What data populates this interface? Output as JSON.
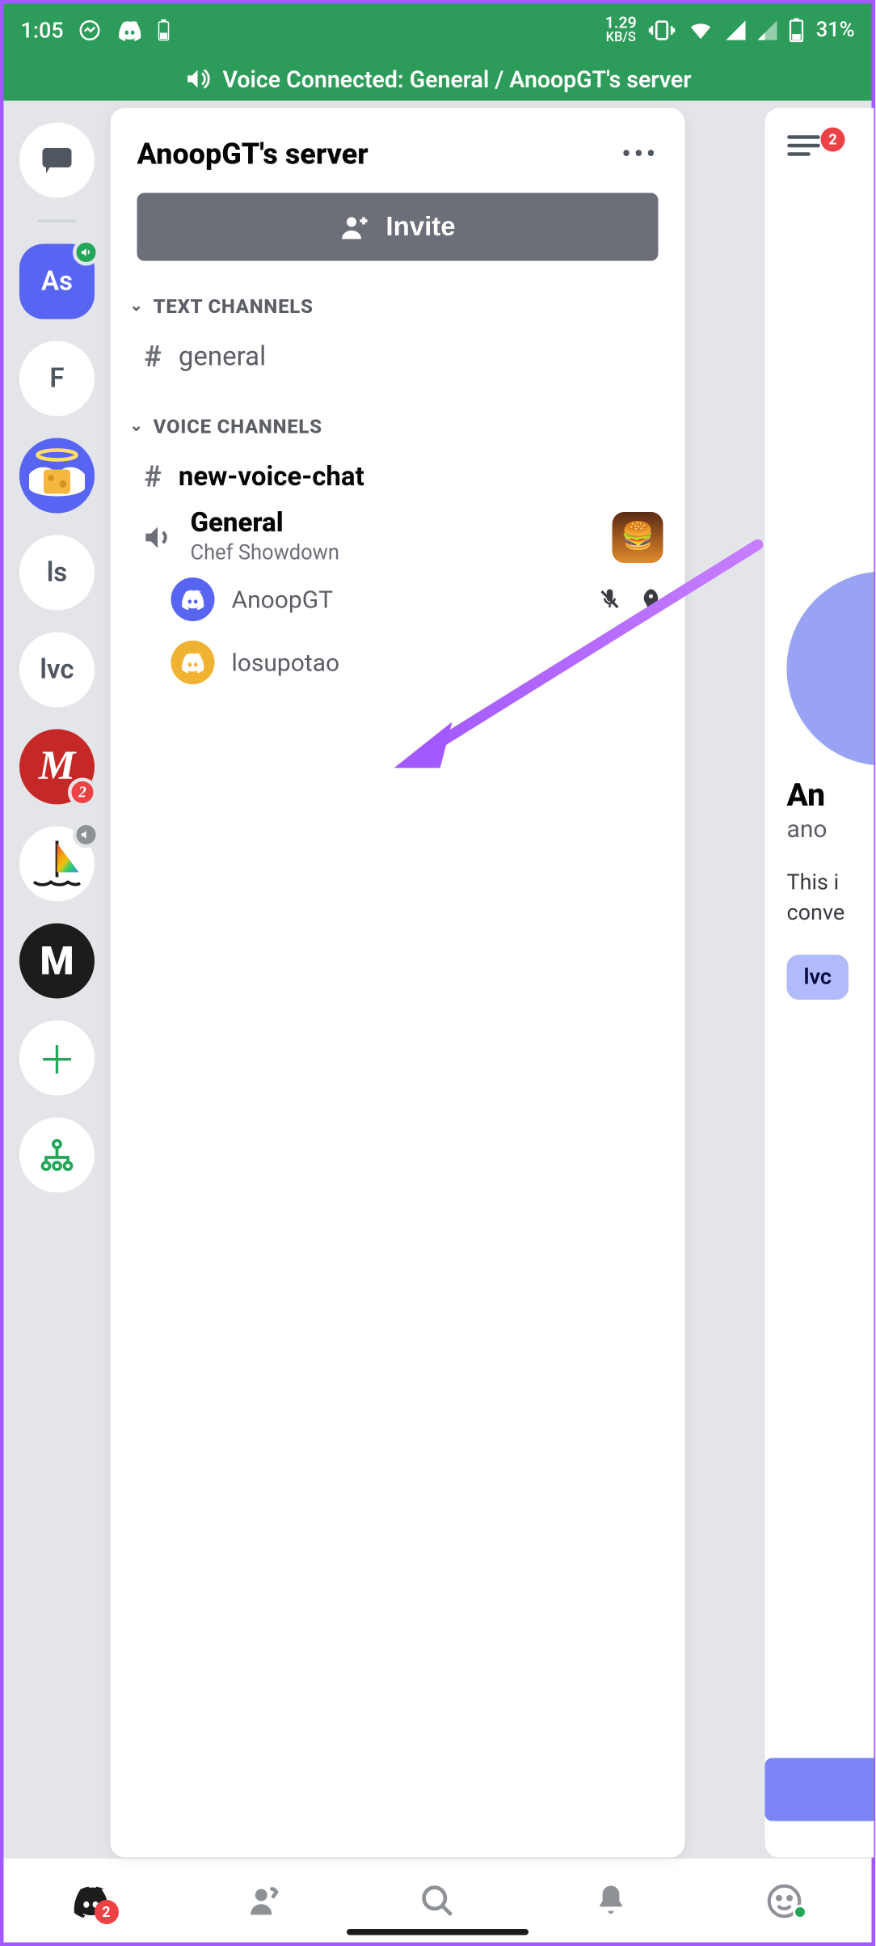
{
  "status": {
    "time": "1:05",
    "net_speed": "1.29",
    "net_unit": "KB/S",
    "battery": "31%"
  },
  "voice_banner": "Voice Connected: General / AnoopGT's server",
  "server": {
    "title": "AnoopGT's server",
    "invite_label": "Invite"
  },
  "sections": {
    "text_label": "TEXT CHANNELS",
    "voice_label": "VOICE CHANNELS"
  },
  "text_channels": [
    {
      "name": "general"
    }
  ],
  "voice_channels": {
    "new_chat": "new-voice-chat",
    "general": {
      "name": "General",
      "activity": "Chef Showdown",
      "users": [
        {
          "name": "AnoopGT",
          "color": "blurple",
          "muted": true,
          "activity": true
        },
        {
          "name": "losupotao",
          "color": "orange",
          "muted": false,
          "activity": false
        }
      ]
    }
  },
  "rail": {
    "active_label": "As",
    "items": [
      "F",
      "",
      "ls",
      "lvc",
      "",
      "M"
    ],
    "m_badge": "2"
  },
  "peek": {
    "menu_badge": "2",
    "name": "An",
    "handle": "ano",
    "desc1": "This i",
    "desc2": "conve",
    "chip": "lvc"
  },
  "tabs": {
    "discord_badge": "2"
  }
}
